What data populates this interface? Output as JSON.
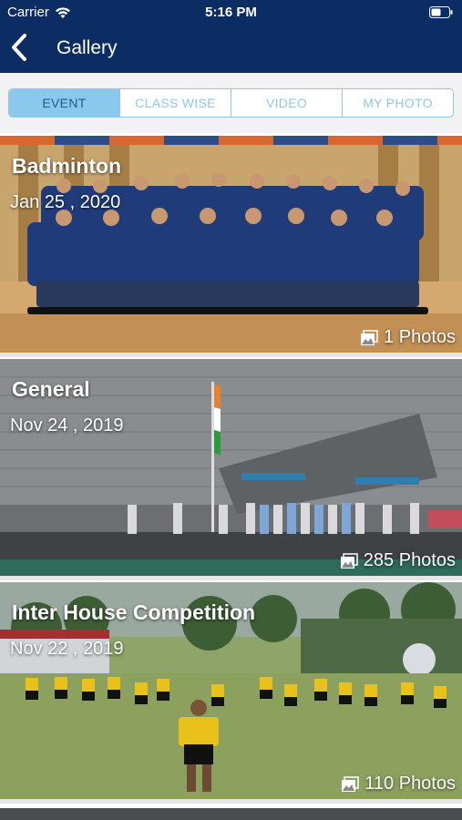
{
  "status_bar": {
    "carrier": "Carrier",
    "time": "5:16 PM"
  },
  "nav": {
    "title": "Gallery",
    "back_icon": "chevron-left-icon"
  },
  "tabs": [
    {
      "label": "EVENT",
      "active": true
    },
    {
      "label": "CLASS WISE",
      "active": false
    },
    {
      "label": "VIDEO",
      "active": false
    },
    {
      "label": "MY PHOTO",
      "active": false
    }
  ],
  "albums": [
    {
      "title": "Badminton",
      "date": "Jan 25 , 2020",
      "count": "1 Photos"
    },
    {
      "title": "General",
      "date": "Nov 24 , 2019",
      "count": "285 Photos"
    },
    {
      "title": "Inter House Competition",
      "date": "Nov 22 , 2019",
      "count": "110 Photos"
    }
  ],
  "colors": {
    "header": "#0b2d63",
    "tab_accent": "#8cc8ec",
    "active_tab_text": "#1a5a95"
  }
}
